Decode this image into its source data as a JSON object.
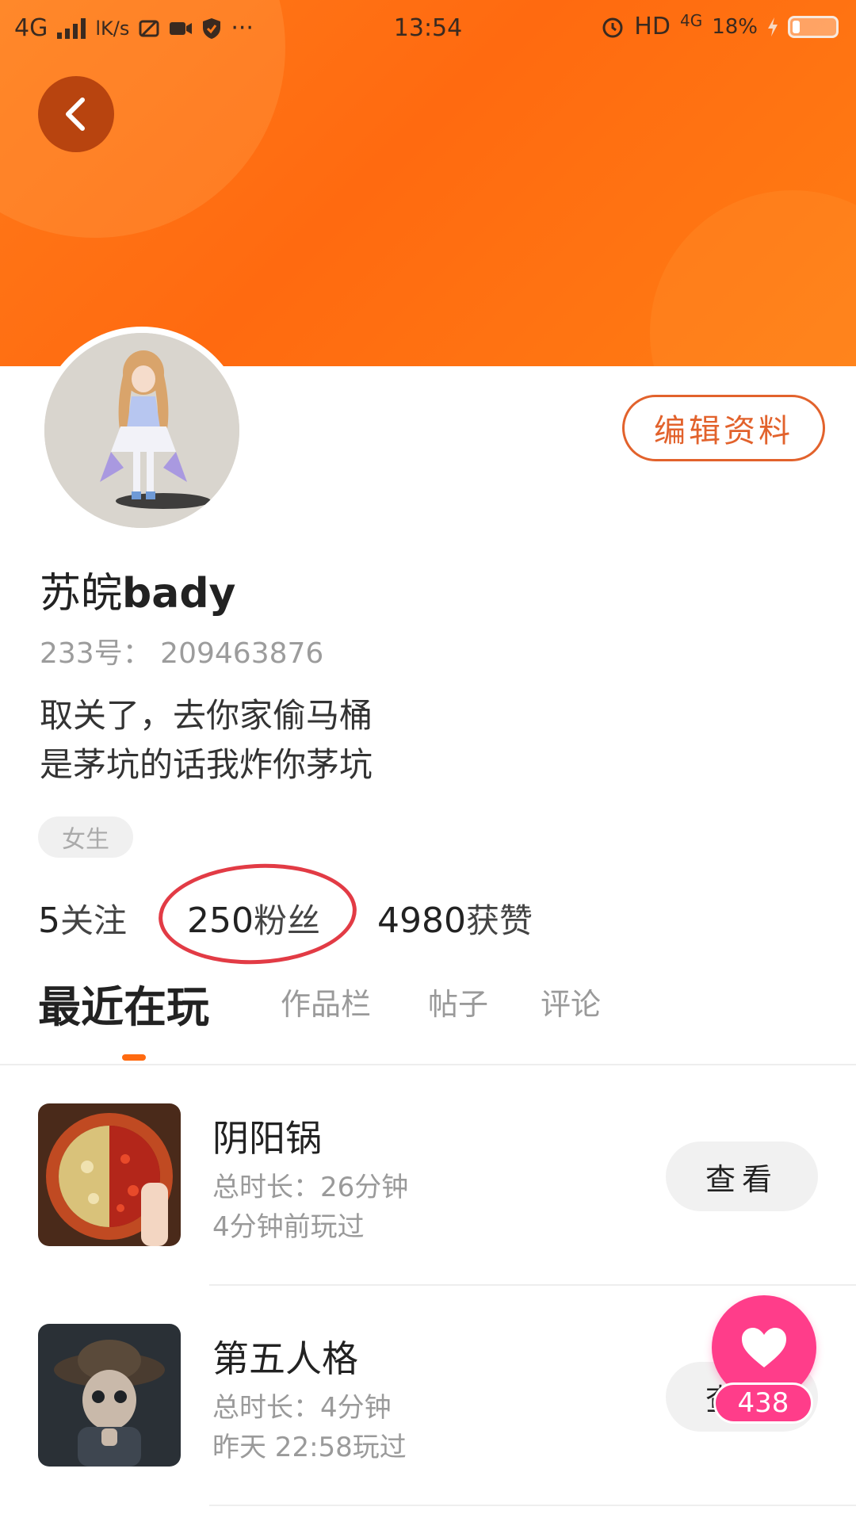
{
  "status_bar": {
    "network": "4G",
    "speed": "lK/s",
    "more": "···",
    "time": "13:54",
    "hd": "HD",
    "net_type": "4G",
    "battery": "18%",
    "battery_level": 0.18
  },
  "profile": {
    "username_cjk": "苏皖",
    "username_latin": "bady",
    "uid_label": "233号：",
    "uid_value": "209463876",
    "bio_line1": "取关了，去你家偷马桶",
    "bio_line2": "是茅坑的话我炸你茅坑",
    "gender_tag": "女生",
    "edit_button": "编辑资料"
  },
  "stats": {
    "following_count": "5",
    "following_label": "关注",
    "fans_count": "250",
    "fans_label": "粉丝",
    "likes_count": "4980",
    "likes_label": "获赞"
  },
  "tabs": [
    {
      "label": "最近在玩",
      "active": true
    },
    {
      "label": "作品栏",
      "active": false
    },
    {
      "label": "帖子",
      "active": false
    },
    {
      "label": "评论",
      "active": false
    }
  ],
  "games": [
    {
      "title": "阴阳锅",
      "duration": "总时长：26分钟",
      "last_played": "4分钟前玩过",
      "button": "查看"
    },
    {
      "title": "第五人格",
      "duration": "总时长：4分钟",
      "last_played": "昨天 22:58玩过",
      "button": "查看"
    }
  ],
  "like_fab": {
    "count": "438"
  },
  "colors": {
    "header_orange": "#ff6a10",
    "accent": "#e2622c",
    "highlight_circle": "#e23b45",
    "like_pink": "#ff3d8a"
  }
}
